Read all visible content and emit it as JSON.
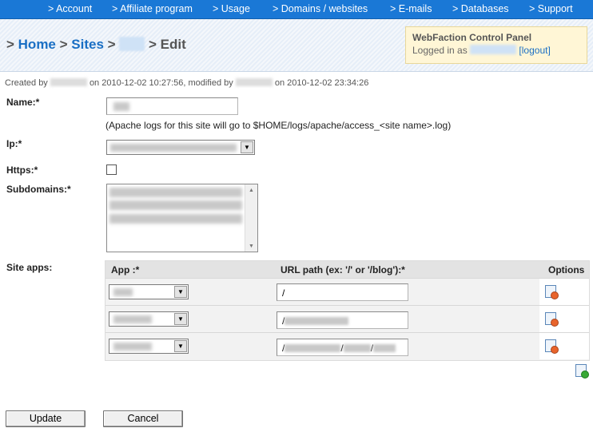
{
  "nav": {
    "account": "> Account",
    "affiliate": "> Affiliate program",
    "usage": "> Usage",
    "domains": "> Domains / websites",
    "emails": "> E-mails",
    "databases": "> Databases",
    "support": "> Support"
  },
  "breadcrumb": {
    "sep1": "> ",
    "home": "Home",
    "sep2": " > ",
    "sites": "Sites",
    "sep3": " > ",
    "sep4": " > ",
    "current": "Edit"
  },
  "panel": {
    "title": "WebFaction Control Panel",
    "logged_in_as": "Logged in as",
    "logout": "[logout]"
  },
  "meta": {
    "created_by": "Created by",
    "created_on": "on 2010-12-02 10:27:56, modified by",
    "modified_on": "on 2010-12-02 23:34:26"
  },
  "form": {
    "name_label": "Name:*",
    "name_note": "(Apache logs for this site will go to $HOME/logs/apache/access_<site name>.log)",
    "ip_label": "Ip:*",
    "https_label": "Https:*",
    "subdomains_label": "Subdomains:*",
    "site_apps_label": "Site apps:"
  },
  "apps_table": {
    "headers": {
      "app": "App :*",
      "url_path": "URL path (ex: '/' or '/blog'):*",
      "options": "Options"
    },
    "rows": [
      {
        "url_prefix": "/",
        "url_blur": []
      },
      {
        "url_prefix": "/",
        "url_blur": [
          80
        ]
      },
      {
        "url_prefix": "/",
        "url_blur": [
          70,
          34,
          28
        ]
      }
    ]
  },
  "buttons": {
    "update": "Update",
    "cancel": "Cancel"
  },
  "colors": {
    "nav_bg": "#1a78d6",
    "link": "#1a6fc4",
    "panel_bg": "#fff6d6"
  }
}
